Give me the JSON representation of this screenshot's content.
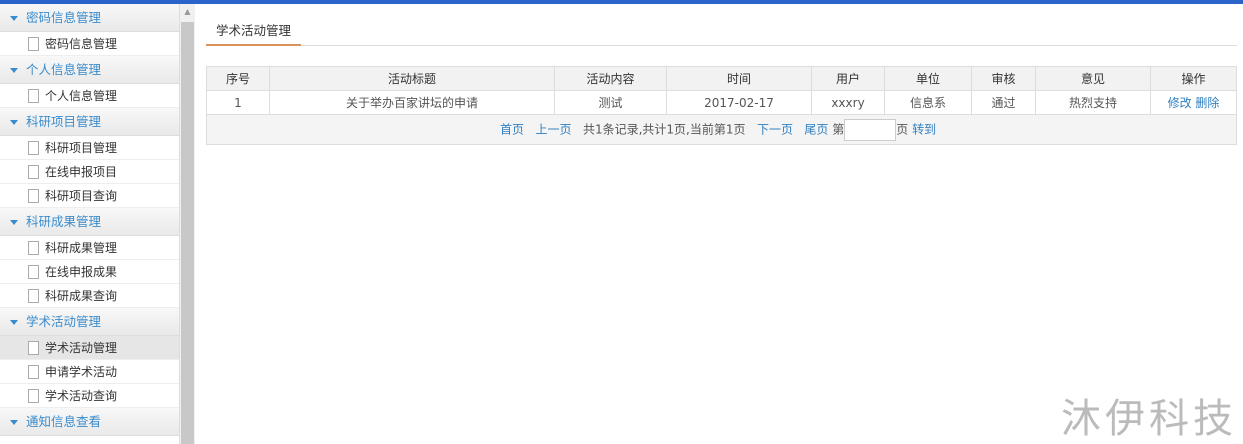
{
  "sidebar": {
    "groups": [
      {
        "label": "密码信息管理",
        "items": [
          "密码信息管理"
        ]
      },
      {
        "label": "个人信息管理",
        "items": [
          "个人信息管理"
        ]
      },
      {
        "label": "科研项目管理",
        "items": [
          "科研项目管理",
          "在线申报项目",
          "科研项目查询"
        ]
      },
      {
        "label": "科研成果管理",
        "items": [
          "科研成果管理",
          "在线申报成果",
          "科研成果查询"
        ]
      },
      {
        "label": "学术活动管理",
        "items": [
          "学术活动管理",
          "申请学术活动",
          "学术活动查询"
        ]
      },
      {
        "label": "通知信息查看",
        "items": []
      }
    ],
    "active": "学术活动管理"
  },
  "tab": "学术活动管理",
  "table": {
    "headers": [
      "序号",
      "活动标题",
      "活动内容",
      "时间",
      "用户",
      "单位",
      "审核",
      "意见",
      "操作"
    ],
    "rows": [
      {
        "no": "1",
        "title": "关于举办百家讲坛的申请",
        "content": "测试",
        "time": "2017-02-17",
        "user": "xxxry",
        "unit": "信息系",
        "review": "通过",
        "opinion": "热烈支持",
        "edit": "修改",
        "delete": "删除"
      }
    ]
  },
  "pager": {
    "first": "首页",
    "prev": "上一页",
    "info": "共1条记录,共计1页,当前第1页",
    "next": "下一页",
    "last": "尾页",
    "page_prefix": "第",
    "page_suffix": "页",
    "go": "转到",
    "page_value": ""
  },
  "watermark": "沐伊科技"
}
